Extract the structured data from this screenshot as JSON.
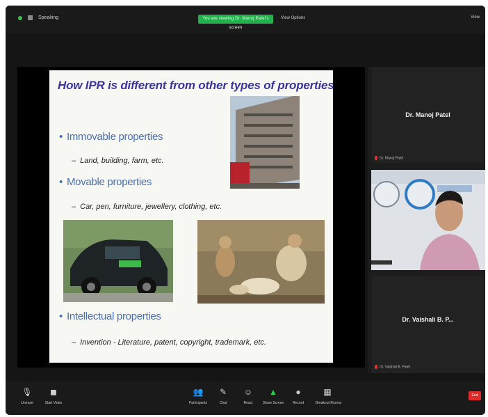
{
  "topbar": {
    "view_label": "Speaking",
    "recording_banner": "You are viewing Dr. Manoj Patel's screen",
    "view_options": "View Options",
    "right_label": "View"
  },
  "slide": {
    "title": "How IPR is different from other types of properties?",
    "bullets": [
      {
        "text": "Immovable properties",
        "sub": "Land, building, farm, etc."
      },
      {
        "text": "Movable properties",
        "sub": "Car, pen, furniture, jewellery, clothing, etc."
      },
      {
        "text": "Intellectual properties",
        "sub": "Invention - Literature, patent, copyright, trademark, etc."
      }
    ],
    "bullet_mark": "•",
    "dash": "–"
  },
  "participants": {
    "top_name": "Dr. Manoj Patel",
    "top_label": "Dr. Manoj Patel",
    "video_label": "Participant",
    "bottom_name": "Dr. Vaishali B. P...",
    "bottom_label": "Dr. Vaishali B. Patel"
  },
  "toolbar": {
    "items": [
      {
        "icon": "mic-icon",
        "glyph": "🎙",
        "label": "Unmute"
      },
      {
        "icon": "video-icon",
        "glyph": "◼",
        "label": "Start Video"
      },
      {
        "icon": "participants-icon",
        "glyph": "👥",
        "label": "Participants"
      },
      {
        "icon": "chat-icon",
        "glyph": "✎",
        "label": "Chat"
      },
      {
        "icon": "reactions-icon",
        "glyph": "☺",
        "label": "React"
      },
      {
        "icon": "share-icon",
        "glyph": "▲",
        "label": "Share Screen"
      },
      {
        "icon": "record-icon",
        "glyph": "●",
        "label": "Record"
      },
      {
        "icon": "apps-icon",
        "glyph": "▦",
        "label": "Breakout Rooms"
      }
    ],
    "end_label": "End"
  },
  "colors": {
    "accent_green": "#22b14c",
    "slide_title": "#3a35a0",
    "bullet_blue": "#4a6fb0",
    "end_red": "#e02b2b"
  }
}
